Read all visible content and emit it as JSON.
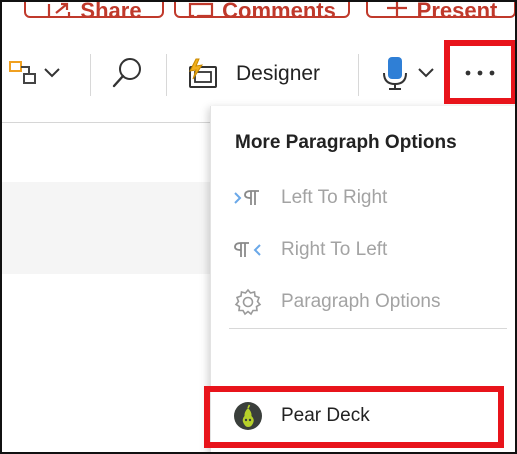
{
  "top_buttons": {
    "share": "Share",
    "comments": "Comments",
    "present": "Present"
  },
  "toolbar": {
    "designer": "Designer"
  },
  "menu": {
    "title": "More Paragraph Options",
    "items": [
      {
        "label": "Left To Right",
        "icon": "ltr-icon",
        "enabled": false
      },
      {
        "label": "Right To Left",
        "icon": "rtl-icon",
        "enabled": false
      },
      {
        "label": "Paragraph Options",
        "icon": "gear-icon",
        "enabled": false
      }
    ],
    "addin": {
      "label": "Pear Deck",
      "icon": "pear-deck-icon"
    }
  },
  "colors": {
    "highlight": "#e8141b",
    "share_red": "#c0392b",
    "disabled_text": "#a3a3a3",
    "dictate_blue": "#2f7fd6"
  }
}
